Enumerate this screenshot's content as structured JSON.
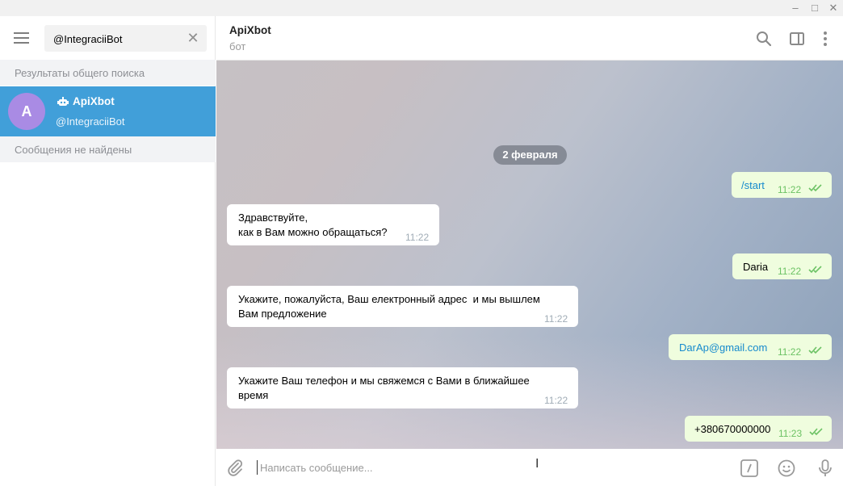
{
  "window": {
    "minimize_icon": "minimize-icon",
    "maximize_icon": "maximize-icon",
    "close_icon": "close-icon",
    "minimize_glyph": "–",
    "maximize_glyph": "□",
    "close_glyph": "✕"
  },
  "sidebar": {
    "search": {
      "value": "@IntegraciiBot",
      "clear_glyph": "✕"
    },
    "global_results_header": "Результаты общего поиска",
    "result": {
      "avatar_letter": "A",
      "avatar_color": "#a98be4",
      "name": "ApiXbot",
      "username": "@IntegraciiBot",
      "selected_color": "#419fd9"
    },
    "messages_not_found": "Сообщения не найдены"
  },
  "chat": {
    "title": "ApiXbot",
    "status": "бот",
    "date_divider": "2 февраля",
    "messages": [
      {
        "direction": "out",
        "text": "/start",
        "time": "11:22",
        "kind": "cmd"
      },
      {
        "direction": "in",
        "text": "Здравствуйте,\nкак в Вам можно обращаться?",
        "time": "11:22"
      },
      {
        "direction": "out",
        "text": "Daria",
        "time": "11:22"
      },
      {
        "direction": "in",
        "text": "Укажите, пожалуйста, Ваш електронный адрес  и мы вышлем\nВам предложение",
        "time": "11:22"
      },
      {
        "direction": "out",
        "text": "DarAp@gmail.com",
        "time": "11:22",
        "kind": "link"
      },
      {
        "direction": "in",
        "text": "Укажите Ваш телефон и мы свяжемся с Вами в ближайшее\nвремя",
        "time": "11:22"
      },
      {
        "direction": "out",
        "text": "+380670000000",
        "time": "11:23"
      }
    ]
  },
  "composer": {
    "placeholder": "Написать сообщение..."
  },
  "colors": {
    "accent": "#419fd9",
    "outgoing_bubble": "#effdde",
    "incoming_bubble": "#ffffff",
    "read_checks": "#6cc264",
    "link": "#168acd"
  }
}
